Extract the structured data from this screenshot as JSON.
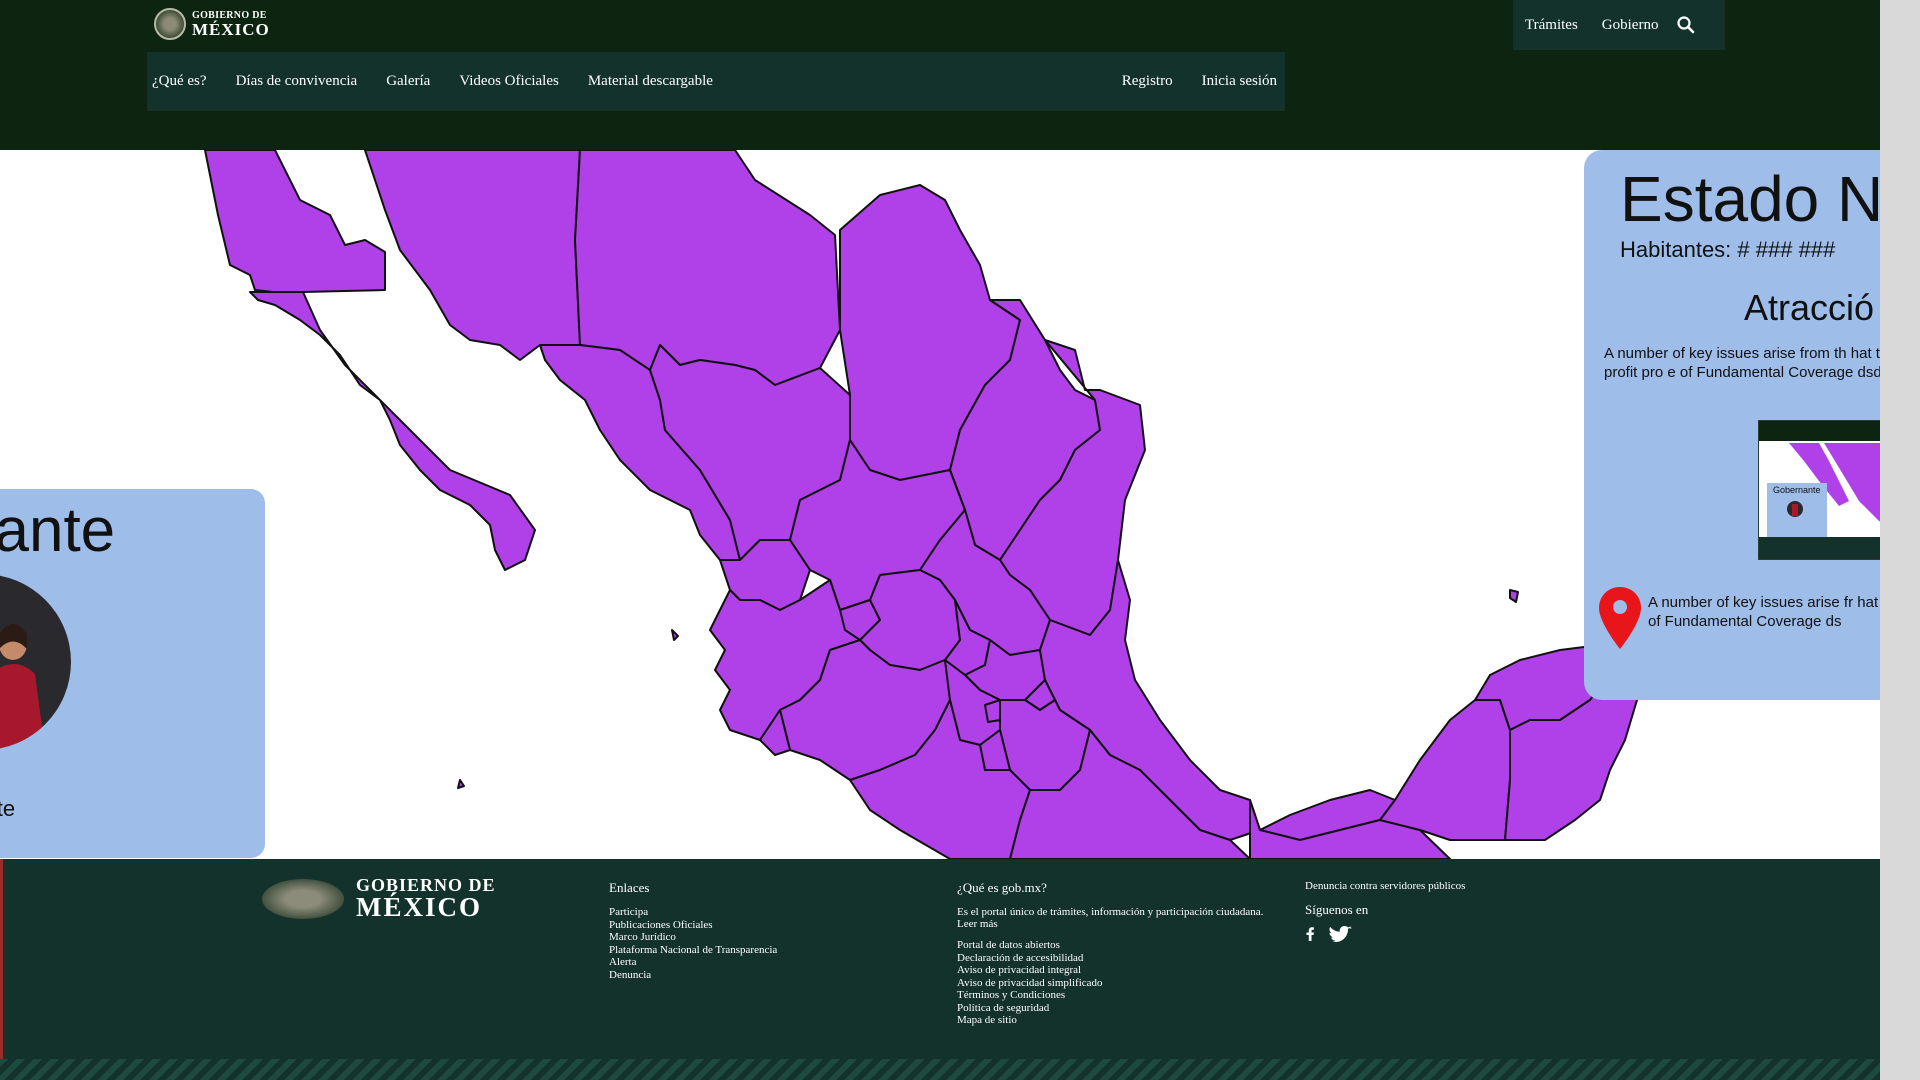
{
  "header": {
    "logo": {
      "line1": "GOBIERNO DE",
      "line2": "MÉXICO"
    },
    "top_links": [
      "Trámites",
      "Gobierno"
    ],
    "search_icon": "search-icon",
    "nav_left": [
      "¿Qué es?",
      "Días de convivencia",
      "Galería",
      "Videos Oficiales",
      "Material descargable"
    ],
    "nav_right": [
      "Registro",
      "Inicia sesión"
    ],
    "colors": {
      "header_bg": "#0d2510",
      "nav_bg": "#13322b"
    }
  },
  "map": {
    "fill": "#b041e8",
    "stroke": "#111111"
  },
  "governor_card": {
    "title": "nante",
    "subtitle": "nante",
    "bg": "#9ebde9"
  },
  "state_card": {
    "title": "Estado N",
    "habitantes": "Habitantes: # ### ###",
    "attractions": "Atracció",
    "description": "A number of key issues arise from th hat the patterns of the the profit pro e of Fundamental Coverage dsdsdsc",
    "description2": "A number of key issues arise fr hat the patterns of the the pro e of Fundamental Coverage ds",
    "thumbnail_label": "Gobernante",
    "pin_icon": "map-pin-icon"
  },
  "footer": {
    "logo": {
      "line1": "GOBIERNO DE",
      "line2": "MÉXICO"
    },
    "enlaces": {
      "heading": "Enlaces",
      "items": [
        "Participa",
        "Publicaciones Oficiales",
        "Marco Jurídico",
        "Plataforma Nacional de Transparencia",
        "Alerta",
        "Denuncia"
      ]
    },
    "que_es": {
      "heading": "¿Qué es gob.mx?",
      "paragraph": "Es el portal único de trámites, información y participación ciudadana. Leer más",
      "items": [
        "Portal de datos abiertos",
        "Declaración de accesibilidad",
        "Aviso de privacidad integral",
        "Aviso de privacidad simplificado",
        "Términos y Condiciones",
        "Política de seguridad",
        "Mapa de sitio"
      ]
    },
    "denuncia": {
      "heading": "Denuncia contra servidores públicos",
      "siguenos": "Síguenos en",
      "social": [
        "facebook-icon",
        "twitter-icon"
      ]
    }
  }
}
